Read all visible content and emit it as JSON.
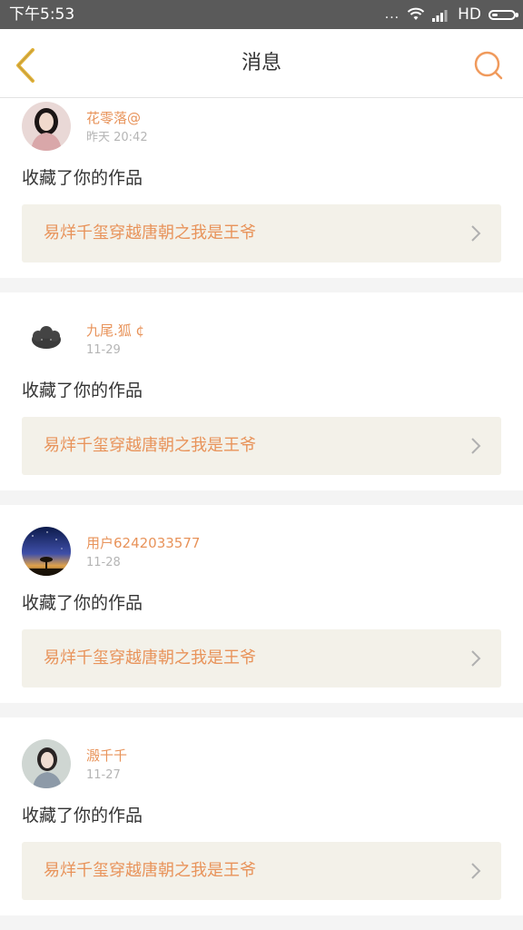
{
  "status_bar": {
    "time": "下午5:53",
    "dots": "...",
    "network": "HD"
  },
  "header": {
    "title": "消息"
  },
  "messages": [
    {
      "username": "花零落@",
      "time": "昨天 20:42",
      "action": "收藏了你的作品",
      "work_title": "易烊千玺穿越唐朝之我是王爷"
    },
    {
      "username": "九尾.狐 ¢",
      "time": "11-29",
      "action": "收藏了你的作品",
      "work_title": "易烊千玺穿越唐朝之我是王爷"
    },
    {
      "username": "用户6242033577",
      "time": "11-28",
      "action": "收藏了你的作品",
      "work_title": "易烊千玺穿越唐朝之我是王爷"
    },
    {
      "username": "溵千千",
      "time": "11-27",
      "action": "收藏了你的作品",
      "work_title": "易烊千玺穿越唐朝之我是王爷"
    }
  ],
  "colors": {
    "accent": "#e8935a",
    "back_icon": "#e2b33c",
    "status_bar_bg": "#5a5a5a",
    "work_box_bg": "#f3f1e9"
  },
  "icons": {
    "back": "chevron-left-icon",
    "search": "search-icon",
    "work_arrow": "chevron-right-icon"
  }
}
